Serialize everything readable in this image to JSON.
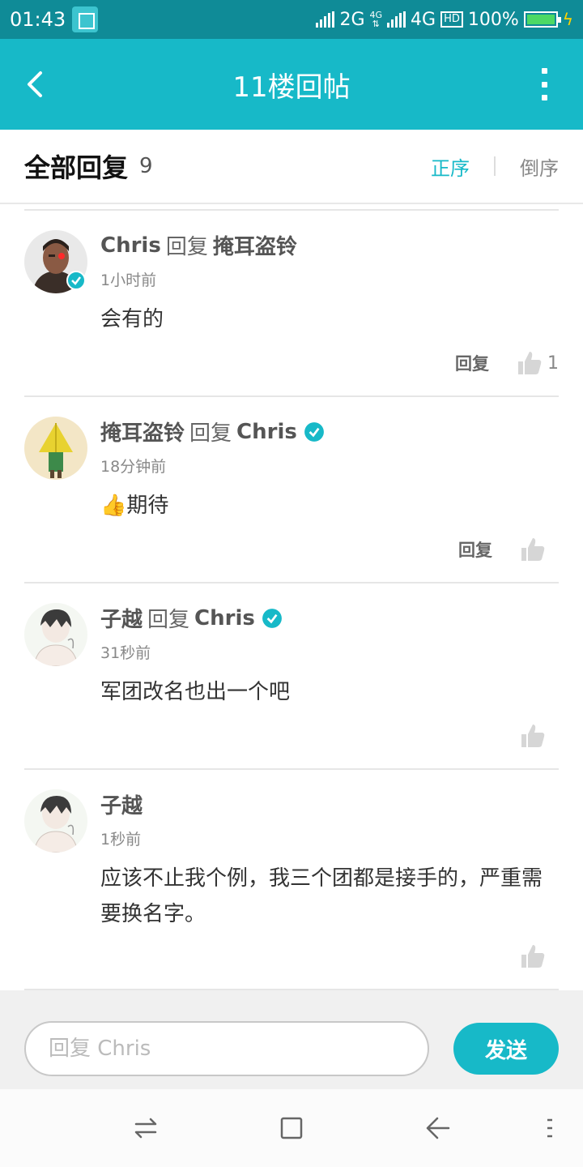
{
  "status_bar": {
    "time": "01:43",
    "network1": "2G",
    "network2_top": "4G",
    "network2_bottom": "⇅",
    "network3": "4G",
    "hd": "HD",
    "battery": "100%"
  },
  "titlebar": {
    "title": "11楼回帖"
  },
  "header": {
    "title": "全部回复",
    "count": "9",
    "sort_asc": "正序",
    "sort_desc": "倒序"
  },
  "comments": [
    {
      "author": "Chris",
      "reply_word": "回复",
      "target": "掩耳盗铃",
      "time": "1小时前",
      "text": "会有的",
      "reply_label": "回复",
      "likes": "1"
    },
    {
      "author": "掩耳盗铃",
      "reply_word": "回复",
      "target": "Chris",
      "time": "18分钟前",
      "text": "👍期待",
      "reply_label": "回复",
      "likes": ""
    },
    {
      "author": "子越",
      "reply_word": "回复",
      "target": "Chris",
      "time": "31秒前",
      "text": "军团改名也出一个吧",
      "likes": ""
    },
    {
      "author": "子越",
      "time": "1秒前",
      "text": "应该不止我个例，我三个团都是接手的，严重需要换名字。",
      "likes": ""
    }
  ],
  "reply_bar": {
    "placeholder": "回复 Chris",
    "send_label": "发送"
  },
  "colors": {
    "accent": "#17b9c8",
    "status_bar": "#0f8b97"
  }
}
